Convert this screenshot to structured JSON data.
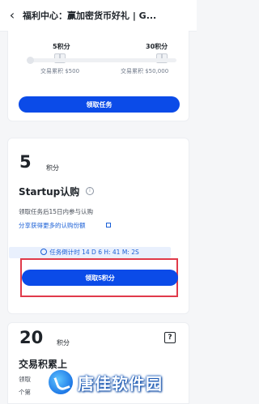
{
  "header": {
    "back_icon": "chevron-left-icon",
    "title": "福利中心：赢加密货币好礼 | G..."
  },
  "card_top": {
    "milestones": [
      {
        "points": "5积分",
        "caption": "交易累积 $500"
      },
      {
        "points": "30积分",
        "caption": "交易累积 $50,000"
      }
    ],
    "progress_percent": 0,
    "button_label": "领取任务"
  },
  "card_startup": {
    "points": "5",
    "points_unit": "积分",
    "title": "Startup认购",
    "info_icon": "info-circle-icon",
    "description": "领取任务后15日内参与认购",
    "link_text": "分享获得更多的认购份额",
    "link_icon": "external-link-icon",
    "countdown": "任务倒计时 14 D 6 H: 41 M: 2S",
    "countdown_icon": "clock-icon",
    "button_label": "领取5积分",
    "highlight_color": "#e03a4a"
  },
  "card_trade": {
    "points": "20",
    "points_unit": "积分",
    "title_partial": "交易积累上",
    "desc_partial_1": "领取",
    "desc_partial_2": "个第",
    "help_icon": "help-square-icon"
  },
  "watermark": {
    "text": "唐佳软件园",
    "logo_icon": "watermark-logo-icon"
  },
  "colors": {
    "accent": "#0b4be8",
    "link": "#1a5fd6",
    "highlight": "#e03a4a"
  }
}
